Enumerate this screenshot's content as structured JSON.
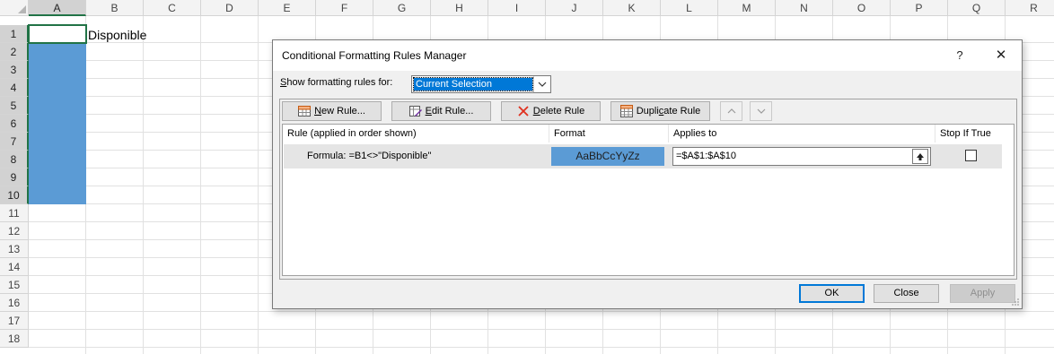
{
  "sheet": {
    "columns": [
      "A",
      "B",
      "C",
      "D",
      "E",
      "F",
      "G",
      "H",
      "I",
      "J",
      "K",
      "L",
      "M",
      "N",
      "O",
      "P",
      "Q",
      "R"
    ],
    "rows": [
      "1",
      "2",
      "3",
      "4",
      "5",
      "6",
      "7",
      "8",
      "9",
      "10",
      "11",
      "12",
      "13",
      "14",
      "15",
      "16",
      "17",
      "18"
    ],
    "selected_column": "A",
    "selected_rows": [
      "1",
      "2",
      "3",
      "4",
      "5",
      "6",
      "7",
      "8",
      "9",
      "10"
    ],
    "cells": {
      "B1": "Disponible"
    },
    "fill_color": "#5b9bd5"
  },
  "dialog": {
    "title": "Conditional Formatting Rules Manager",
    "help_icon": "?",
    "close_icon": "✕",
    "show_rules_label_underlined": "S",
    "show_rules_label_rest": "how formatting rules for:",
    "show_rules_value": "Current Selection",
    "toolbar": {
      "new_rule_mnemonic": "N",
      "new_rule_rest": "ew Rule...",
      "edit_rule_mnemonic": "E",
      "edit_rule_rest": "dit Rule...",
      "delete_rule_mnemonic": "D",
      "delete_rule_rest": "elete Rule",
      "duplicate_rule_pre": "Dupli",
      "duplicate_rule_mnemonic": "c",
      "duplicate_rule_rest": "ate Rule"
    },
    "columns": {
      "rule": "Rule (applied in order shown)",
      "format": "Format",
      "applies_to": "Applies to",
      "stop_if_true": "Stop If True"
    },
    "rules": [
      {
        "rule": "Formula: =B1<>\"Disponible\"",
        "format_preview": "AaBbCcYyZz",
        "applies_to": "=$A$1:$A$10",
        "stop_if_true": false
      }
    ],
    "buttons": {
      "ok": "OK",
      "close": "Close",
      "apply": "Apply"
    },
    "colors": {
      "accent": "#0078d7",
      "format_fill": "#5b9bd5",
      "delete_icon": "#e0301e"
    }
  }
}
